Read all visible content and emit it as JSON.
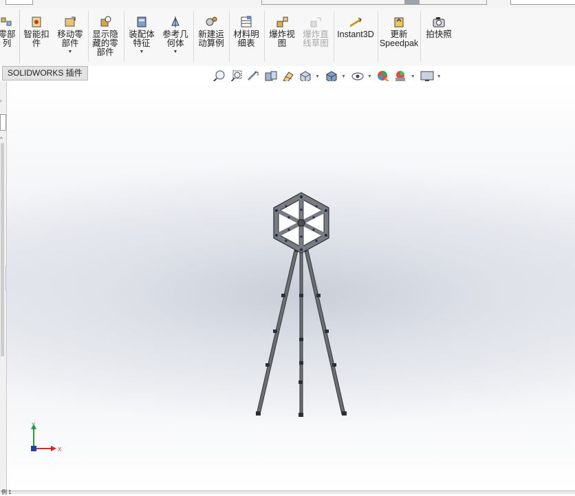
{
  "ribbon": {
    "items": [
      {
        "id": "linear-pattern",
        "label": "零部\n列",
        "disabled": false,
        "caret": false
      },
      {
        "id": "smart-fasteners",
        "label": "智能扣\n件",
        "disabled": false,
        "caret": false
      },
      {
        "id": "move-component",
        "label": "移动零\n部件",
        "disabled": false,
        "caret": true
      },
      {
        "id": "show-hidden-components",
        "label": "显示隐\n藏的零\n部件",
        "disabled": false,
        "caret": false
      },
      {
        "id": "assembly-features",
        "label": "装配体\n特征",
        "disabled": false,
        "caret": true
      },
      {
        "id": "reference-geometry",
        "label": "参考几\n何体",
        "disabled": false,
        "caret": true
      },
      {
        "id": "new-motion-study",
        "label": "新建运\n动算例",
        "disabled": false,
        "caret": false
      },
      {
        "id": "bill-of-materials",
        "label": "材料明\n细表",
        "disabled": false,
        "caret": false
      },
      {
        "id": "exploded-view",
        "label": "爆炸视\n图",
        "disabled": false,
        "caret": false
      },
      {
        "id": "explode-line-sketch",
        "label": "爆炸直\n线草图",
        "disabled": true,
        "caret": false
      },
      {
        "id": "instant3d",
        "label": "Instant3D",
        "disabled": false,
        "caret": false
      },
      {
        "id": "update-speedpak",
        "label": "更新\nSpeedpak",
        "disabled": false,
        "caret": false
      },
      {
        "id": "take-snapshot",
        "label": "拍快照",
        "disabled": false,
        "caret": false
      }
    ]
  },
  "tabs": {
    "addins": "SOLIDWORKS 插件"
  },
  "heads_up_toolbar": [
    "zoom-to-fit-icon",
    "zoom-to-area-icon",
    "previous-view-icon",
    "section-view-icon",
    "dynamic-annotation-icon",
    "view-orientation-icon",
    "display-style-icon",
    "hide-show-items-icon",
    "edit-appearance-icon",
    "apply-scene-icon",
    "view-settings-icon"
  ],
  "triad": {
    "x_label": "X",
    "y_label": "Y"
  },
  "status": {
    "text": "例 1"
  }
}
